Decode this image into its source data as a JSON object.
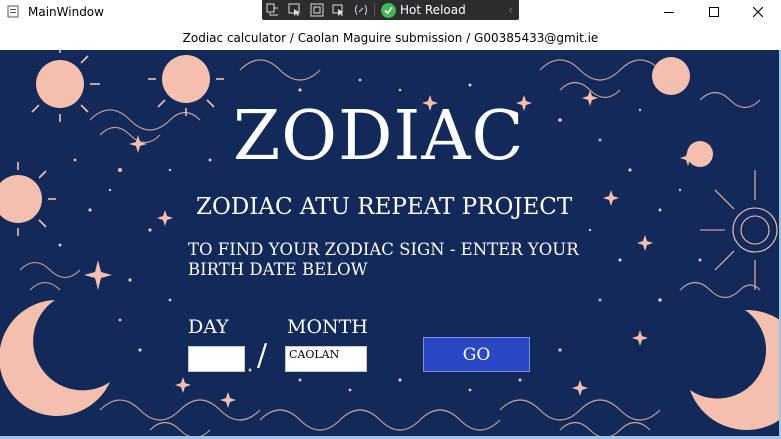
{
  "window": {
    "title": "MainWindow"
  },
  "debug_toolbar": {
    "hot_reload_label": "Hot Reload"
  },
  "header": {
    "text": "Zodiac calculator / Caolan Maguire submission / G00385433@gmit.ie"
  },
  "main": {
    "title": "ZODIAC",
    "subtitle": "ZODIAC ATU REPEAT PROJECT",
    "instructions": "TO FIND YOUR ZODIAC SIGN - ENTER YOUR BIRTH DATE BELOW",
    "day_label": "DAY",
    "month_label": "MONTH",
    "day_value": "",
    "separator": "/",
    "month_value": "CAOLAN",
    "go_label": "GO"
  },
  "colors": {
    "background": "#12295a",
    "accent_peach": "#f4c0ad",
    "go_button": "#2a47c4"
  }
}
